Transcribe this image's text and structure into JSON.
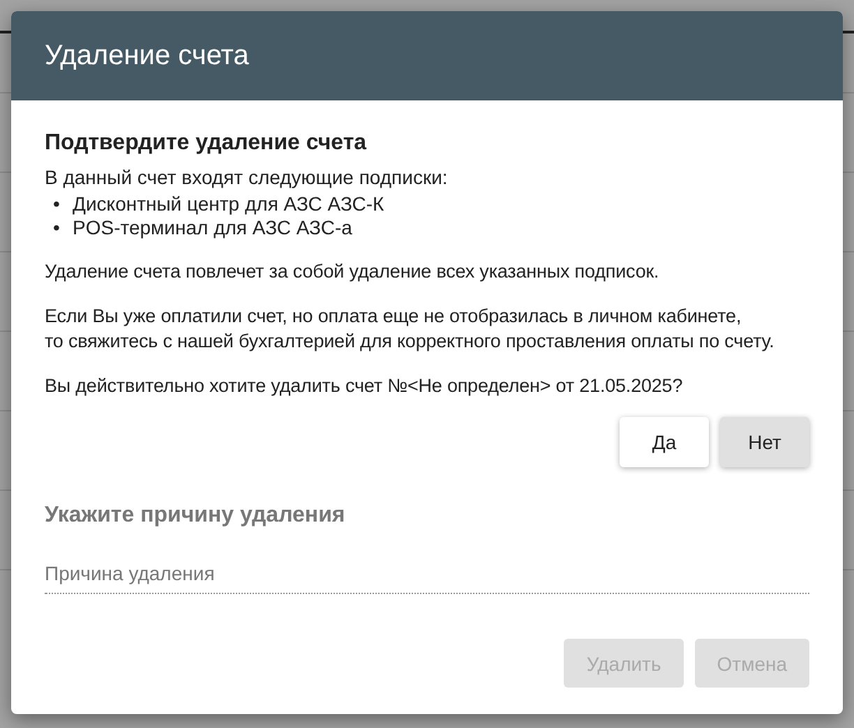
{
  "dialog": {
    "title": "Удаление счета",
    "heading": "Подтвердите удаление счета",
    "intro": "В данный счет входят следующие подписки:",
    "subscriptions": [
      {
        "bullet": "•",
        "text": "Дисконтный центр для АЗС АЗС-К"
      },
      {
        "bullet": "•",
        "text": "POS-терминал для АЗС АЗС-а"
      }
    ],
    "paragraphs": [
      [
        "Удаление счета повлечет за собой удаление всех указанных подписок."
      ],
      [
        "Если Вы уже оплатили счет, но оплата еще не отобразилась в личном кабинете,",
        "то свяжитесь с нашей бухгалтерией для корректного проставления оплаты по счету."
      ],
      [
        "Вы действительно хотите удалить счет №<Не определен> от 21.05.2025?"
      ]
    ],
    "confirm_buttons": [
      {
        "label": "Да",
        "selected": false
      },
      {
        "label": "Нет",
        "selected": true
      }
    ],
    "reason_heading": "Укажите причину удаления",
    "reason_field": {
      "placeholder": "Причина удаления"
    },
    "footer_buttons": [
      {
        "label": "Удалить",
        "disabled": true
      },
      {
        "label": "Отмена",
        "disabled": true
      }
    ]
  }
}
